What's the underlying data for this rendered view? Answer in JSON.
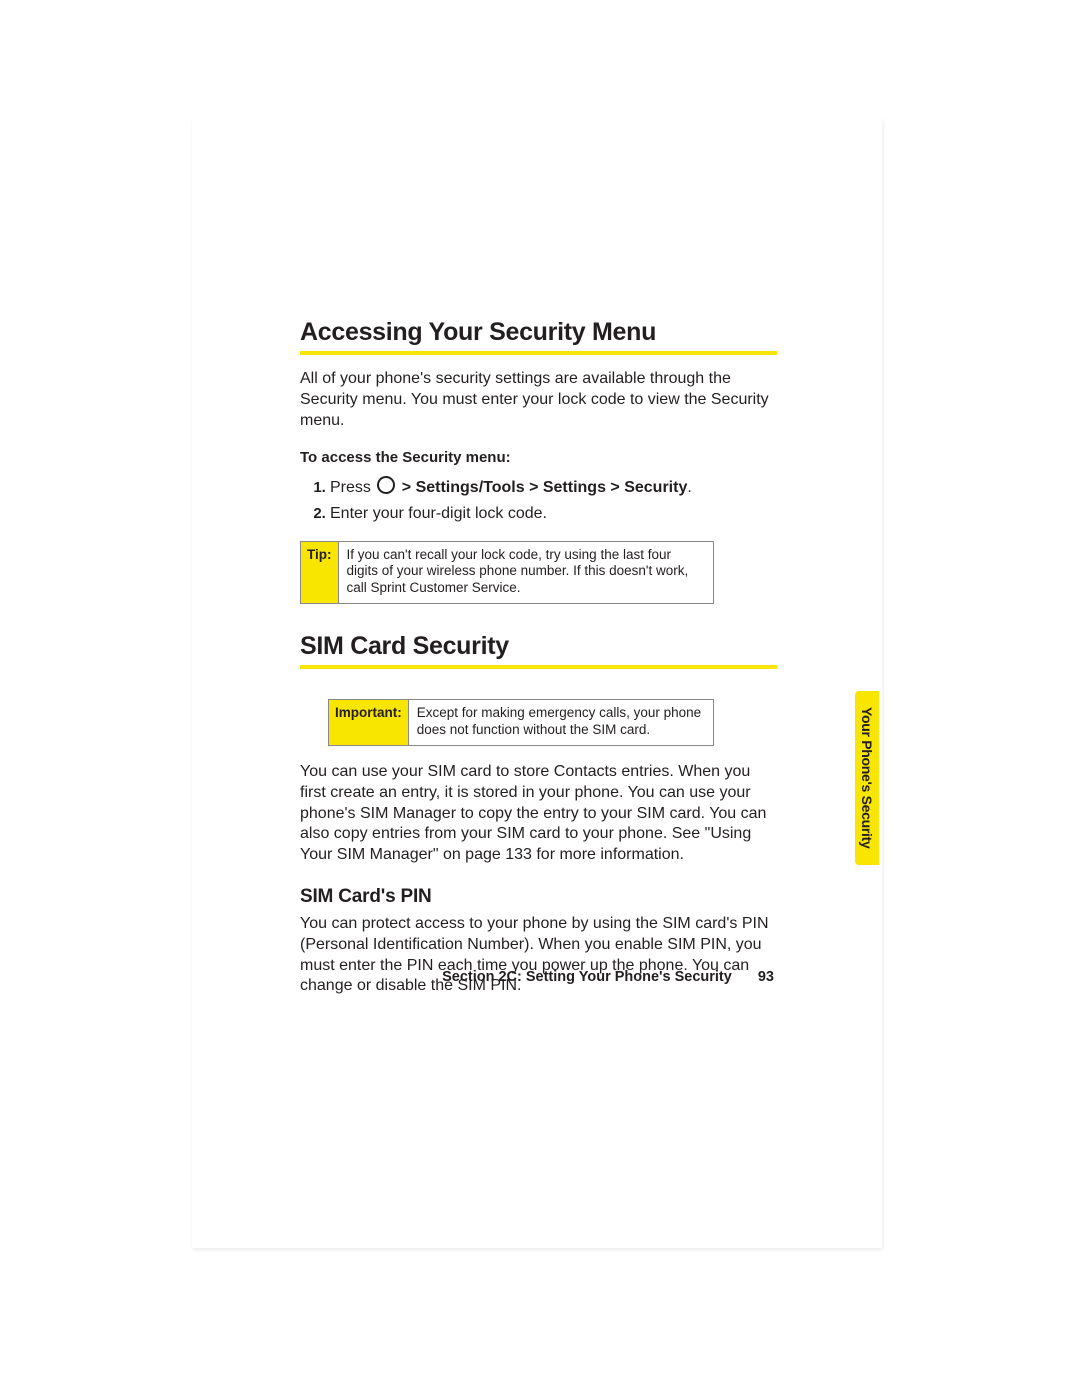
{
  "sideTab": "Your Phone's Security",
  "section1": {
    "heading": "Accessing Your Security Menu",
    "intro": "All of your phone's security settings are available through the Security menu. You must enter your lock code to view the Security menu.",
    "leadIn": "To access the Security menu:",
    "step1_a": "Press ",
    "step1_b": " > Settings/Tools > Settings > Security",
    "step1_c": ".",
    "step2": "Enter your four-digit lock code.",
    "tipLabel": "Tip:",
    "tipText": "If you can't recall your lock code, try using the last four digits of your wireless phone number. If this doesn't work, call Sprint Customer Service."
  },
  "section2": {
    "heading": "SIM Card Security",
    "importantLabel": "Important:",
    "importantText": "Except for making emergency calls, your phone does not function without the SIM card.",
    "para": "You can use your SIM card to store Contacts entries. When you first create an entry, it is stored in your phone. You can use your phone's SIM Manager to copy the entry to your SIM card. You can also copy entries from your SIM card to your phone. See \"Using Your SIM Manager\" on page 133 for more information.",
    "subHeading": "SIM Card's PIN",
    "subPara": "You can protect access to your phone by using the SIM card's PIN (Personal Identification Number). When you enable SIM PIN, you must enter the PIN each time you power up the phone. You can change or disable the SIM PIN."
  },
  "footer": {
    "section": "Section 2C: Setting Your Phone's Security",
    "page": "93"
  }
}
